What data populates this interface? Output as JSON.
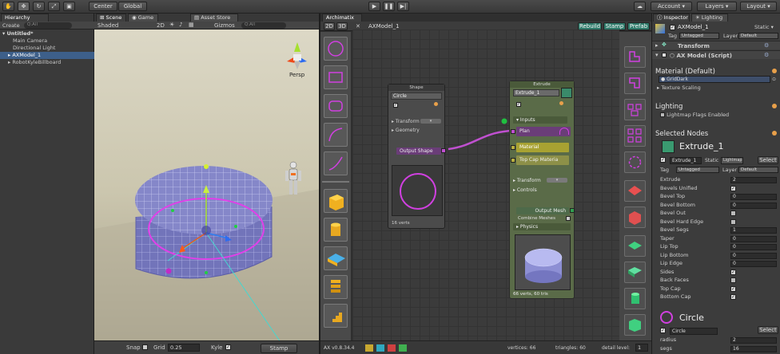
{
  "toolbar": {
    "center": "Center",
    "global": "Global",
    "account": "Account",
    "layers": "Layers",
    "layout": "Layout"
  },
  "hierarchy": {
    "tab": "Hierarchy",
    "create": "Create",
    "search_placeholder": "Q:All",
    "items": [
      "Untitled*",
      "Main Camera",
      "Directional Light",
      "AXModel_1",
      "RobotKyleBillboard"
    ]
  },
  "scene": {
    "tabs": [
      "Scene",
      "Game",
      "Asset Store"
    ],
    "shading": "Shaded",
    "mode_2d": "2D",
    "gizmos": "Gizmos",
    "search": "Q:All",
    "persp": "Persp",
    "bottom": {
      "snap": "Snap",
      "grid_label": "Grid",
      "grid_value": "0.25",
      "kyle": "Kyle",
      "stamp": "Stamp"
    }
  },
  "archimatix": {
    "tab": "Archimatix",
    "btn_2d": "2D",
    "btn_3d": "3D",
    "model": "AXModel_1",
    "rebuild": "Rebuild",
    "stamp": "Stamp",
    "prefab": "Prefab",
    "shape_node": {
      "title": "Shape",
      "name": "Circle",
      "transform": "Transform",
      "geometry": "Geometry",
      "output": "Output Shape",
      "verts": "16 verts"
    },
    "extrude_node": {
      "title": "Extrude",
      "name": "Extrude_1",
      "inputs": "Inputs",
      "plan": "Plan",
      "material": "Material",
      "top_cap": "Top Cap Materia",
      "transform": "Transform",
      "controls": "Controls",
      "output_mesh": "Output Mesh",
      "combine": "Combine Meshes",
      "physics": "Physics",
      "stats": "66 verts, 60 tris"
    },
    "status": {
      "version": "AX v0.8.34.4",
      "vertices": "vertices: 66",
      "triangles": "triangles: 60",
      "detail": "detail level:",
      "detail_value": "1"
    }
  },
  "inspector": {
    "tabs": [
      "Inspector",
      "Lighting"
    ],
    "object": "AXModel_1",
    "static": "Static",
    "tag": "Tag",
    "tag_value": "Untagged",
    "layer": "Layer",
    "layer_value": "Default",
    "transform": "Transform",
    "script": "AX Model (Script)",
    "material_default": "Material (Default)",
    "material_value": "GridDark",
    "texture_scaling": "Texture Scaling",
    "lighting": "Lighting",
    "lightmap": "Lightmap Flags Enabled",
    "selected_nodes": "Selected Nodes",
    "node_name": "Extrude_1",
    "node_row": "Extrude_1",
    "node_static": "Static",
    "node_lightmap": "Lightmap",
    "select": "Select",
    "node_tag_value": "Untagged",
    "node_layer_value": "Default",
    "props": [
      {
        "label": "Extrude",
        "value": "2"
      },
      {
        "label": "Bevels Unified",
        "check": true
      },
      {
        "label": "Bevel Top",
        "value": "0"
      },
      {
        "label": "Bevel Bottom",
        "value": "0"
      },
      {
        "label": "Bevel Out",
        "check": false
      },
      {
        "label": "Bevel Hard Edge",
        "check": false
      },
      {
        "label": "Bevel Segs",
        "value": "1"
      },
      {
        "label": "Taper",
        "value": "0"
      },
      {
        "label": "Lip Top",
        "value": "0"
      },
      {
        "label": "Lip Bottom",
        "value": "0"
      },
      {
        "label": "Lip Edge",
        "value": "0"
      },
      {
        "label": "Sides",
        "check": true
      },
      {
        "label": "Back Faces",
        "check": false
      },
      {
        "label": "Top Cap",
        "check": true
      },
      {
        "label": "Bottom Cap",
        "check": true
      }
    ],
    "circle_header": "Circle",
    "circle_row": "Circle",
    "circle_select": "Select",
    "radius_label": "radius",
    "radius_value": "2",
    "segs_label": "segs",
    "segs_value": "16"
  }
}
